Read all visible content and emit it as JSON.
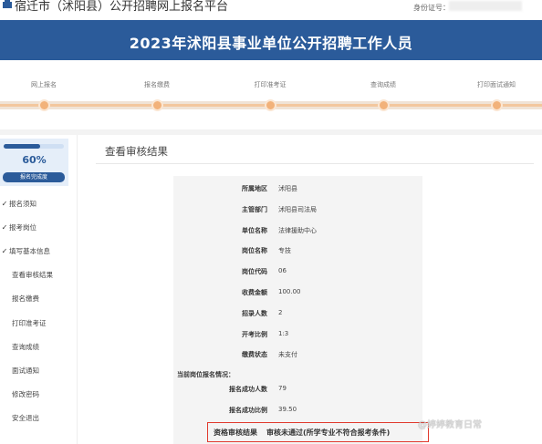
{
  "header": {
    "site_title": "宿迁市（沭阳县）公开招聘网上报名平台",
    "id_label": "身份证号：",
    "logo_icon": "building-logo-icon"
  },
  "banner": {
    "title": "2023年沭阳县事业单位公开招聘工作人员",
    "color": "#2b5b9a"
  },
  "steps": [
    "网上报名",
    "报名缴费",
    "打印准考证",
    "查询成绩",
    "打印面试通知"
  ],
  "sidebar": {
    "progress_fraction": 0.6,
    "percent": "60%",
    "badge": "报名完成度",
    "items": [
      {
        "label": "报名须知",
        "done": true,
        "check": "✓"
      },
      {
        "label": "报考岗位",
        "done": true,
        "check": "✓"
      },
      {
        "label": "填写基本信息",
        "done": true,
        "check": "✓"
      },
      {
        "label": "查看审核结果",
        "done": false
      },
      {
        "label": "报名缴费",
        "done": false
      },
      {
        "label": "打印准考证",
        "done": false
      },
      {
        "label": "查询成绩",
        "done": false
      },
      {
        "label": "面试通知",
        "done": false
      },
      {
        "label": "修改密码",
        "done": false
      },
      {
        "label": "安全退出",
        "done": false
      }
    ]
  },
  "main": {
    "title": "查看审核结果",
    "details": [
      {
        "label": "所属地区",
        "value": "沭阳县"
      },
      {
        "label": "主管部门",
        "value": "沭阳县司法局"
      },
      {
        "label": "单位名称",
        "value": "法律援助中心"
      },
      {
        "label": "岗位名称",
        "value": "专技"
      },
      {
        "label": "岗位代码",
        "value": "06"
      },
      {
        "label": "收费金额",
        "value": "100.00"
      },
      {
        "label": "招录人数",
        "value": "2"
      },
      {
        "label": "开考比例",
        "value": "1:3"
      },
      {
        "label": "缴费状态",
        "value": "未支付"
      }
    ],
    "section_heading": "当前岗位报名情况：",
    "stats": [
      {
        "label": "报名成功人数",
        "value": "79"
      },
      {
        "label": "报名成功比例",
        "value": "39.50"
      }
    ],
    "result": {
      "label": "资格审核结果",
      "value": "审核未通过(所学专业不符合报考条件)"
    }
  },
  "watermark": "@婷婷教育日常",
  "colors": {
    "accent": "#2b5b9a",
    "progress": "#f2b27a",
    "alert": "#e13a2e"
  }
}
